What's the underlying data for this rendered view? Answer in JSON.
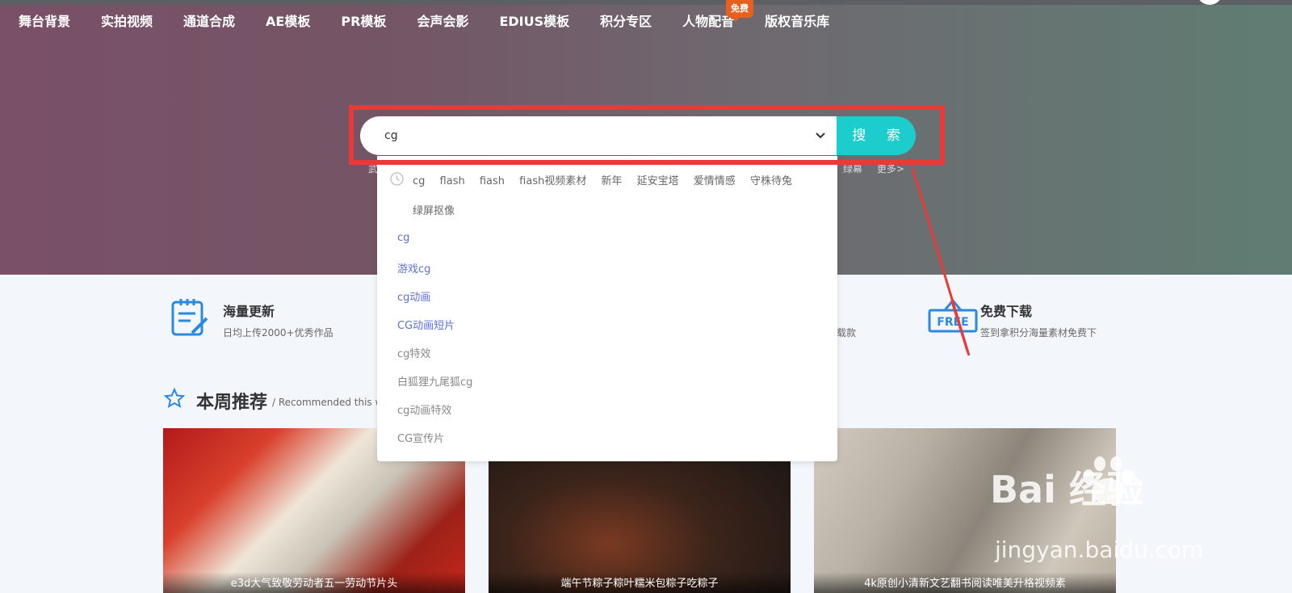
{
  "nav": {
    "items": [
      "舞台背景",
      "实拍视频",
      "通道合成",
      "AE模板",
      "PR模板",
      "会声会影",
      "EDIUS模板",
      "积分专区",
      "人物配音",
      "版权音乐库"
    ],
    "badge": "免费"
  },
  "search": {
    "value": "cg",
    "button_label": "搜 索",
    "hot_left": "武",
    "hot_right": [
      "绿幕",
      "更多>"
    ]
  },
  "dropdown": {
    "history_row1": [
      "cg",
      "flash",
      "fiash",
      "fiash视频素材",
      "新年",
      "延安宝塔",
      "爱情情感",
      "守株待兔"
    ],
    "history_row2": "绿屏抠像",
    "suggestions_blue": [
      "cg",
      "游戏cg",
      "cg动画",
      "CG动画短片"
    ],
    "suggestions_gray": [
      "cg特效",
      "白狐狸九尾狐cg",
      "cg动画特效",
      "CG宣传片"
    ]
  },
  "features": [
    {
      "title": "海量更新",
      "subtitle": "日均上传2000+优秀作品"
    },
    {
      "title": "免费下载",
      "subtitle": "签到拿积分海量素材免费下"
    }
  ],
  "features_partial": "载款",
  "recommend": {
    "title": "本周推荐",
    "subtitle": "/ Recommended this w"
  },
  "cards": [
    {
      "caption": "e3d大气致敬劳动者五一劳动节片头"
    },
    {
      "caption": "端午节粽子粽叶糯米包粽子吃粽子"
    },
    {
      "caption": "4k原创小清新文艺翻书阅读唯美升格视频素"
    }
  ],
  "watermark": {
    "brand": "Bai  经验",
    "url": "jingyan.baidu.com"
  },
  "icons": [
    "clock-icon",
    "chevron-down-icon",
    "clipboard-edit-icon",
    "free-sign-icon",
    "star-icon",
    "baidu-paw-icon"
  ],
  "colors": {
    "search_button": "#1dcdce",
    "annotation_red": "#e93a3a",
    "badge": "#e8601e",
    "suggestion_blue": "#5c6fd4"
  }
}
